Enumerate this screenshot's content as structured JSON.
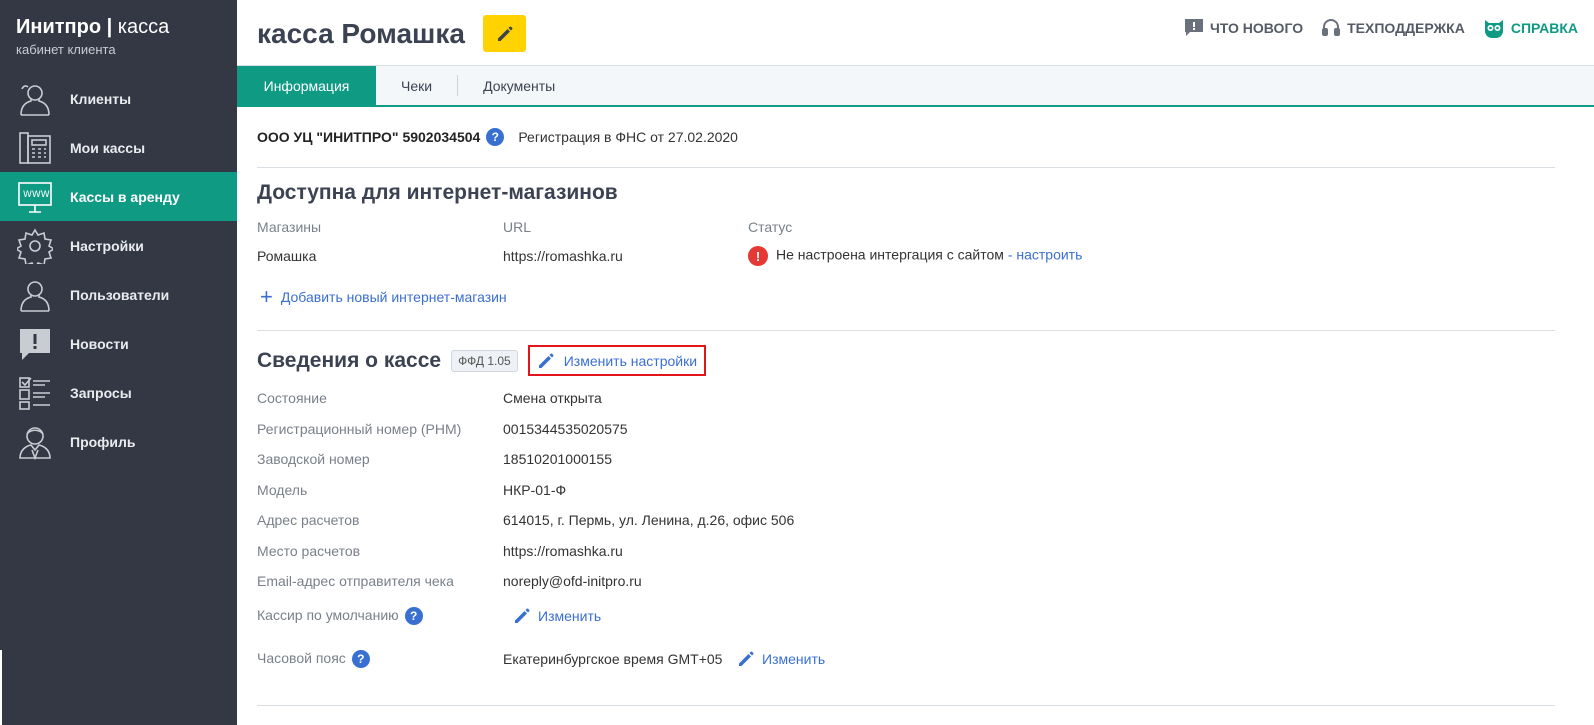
{
  "brand": {
    "name": "Инитпро",
    "separator": "|",
    "product": "касса",
    "subtitle": "кабинет клиента"
  },
  "sidebar": {
    "items": [
      {
        "label": "Клиенты",
        "icon": "users-icon",
        "active": false
      },
      {
        "label": "Мои кассы",
        "icon": "cash-register-icon",
        "active": false
      },
      {
        "label": "Кассы в аренду",
        "icon": "www-monitor-icon",
        "active": true
      },
      {
        "label": "Настройки",
        "icon": "gear-icon",
        "active": false
      },
      {
        "label": "Пользователи",
        "icon": "users-icon",
        "active": false
      },
      {
        "label": "Новости",
        "icon": "news-icon",
        "active": false
      },
      {
        "label": "Запросы",
        "icon": "checklist-icon",
        "active": false
      },
      {
        "label": "Профиль",
        "icon": "profile-icon",
        "active": false
      }
    ]
  },
  "header": {
    "title": "касса Ромашка",
    "links": {
      "whats_new": "ЧТО НОВОГО",
      "support": "ТЕХПОДДЕРЖКА",
      "help": "СПРАВКА"
    }
  },
  "tabs": {
    "info": "Информация",
    "checks": "Чеки",
    "documents": "Документы"
  },
  "org": {
    "name": "ООО УЦ \"ИНИТПРО\" 5902034504",
    "help": "?",
    "registration": "Регистрация в ФНС от 27.02.2020"
  },
  "shops": {
    "title": "Доступна для интернет-магазинов",
    "columns": {
      "shops": "Магазины",
      "url": "URL",
      "status": "Статус"
    },
    "row": {
      "shop": "Ромашка",
      "url": "https://romashka.ru",
      "status": "Не настроена интергация с сайтом",
      "status_link": "- настроить",
      "error_mark": "!"
    },
    "add_plus": "+",
    "add_label": "Добавить новый интернет-магазин"
  },
  "kassa": {
    "title": "Сведения о кассе",
    "ffd": "ФФД 1.05",
    "edit_settings": "Изменить настройки",
    "props": [
      {
        "label": "Состояние",
        "value": "Смена открыта"
      },
      {
        "label": "Регистрационный номер (РНМ)",
        "value": "0015344535020575"
      },
      {
        "label": "Заводской номер",
        "value": "18510201000155"
      },
      {
        "label": "Модель",
        "value": "НКР-01-Ф"
      },
      {
        "label": "Адрес расчетов",
        "value": "614015, г. Пермь, ул. Ленина, д.26, офис 506"
      },
      {
        "label": "Место расчетов",
        "value": "https://romashka.ru"
      },
      {
        "label": "Email-адрес отправителя чека",
        "value": "noreply@ofd-initpro.ru"
      }
    ],
    "cashier": {
      "label": "Кассир по умолчанию",
      "help": "?",
      "edit": "Изменить"
    },
    "timezone": {
      "label": "Часовой пояс",
      "help": "?",
      "value": "Екатеринбургское время GMT+05",
      "edit": "Изменить"
    }
  },
  "colors": {
    "sidebar_bg": "#343844",
    "accent": "#0f9a84",
    "link": "#3a6fd2",
    "error": "#e53935",
    "highlight_border": "#e4141b",
    "title_edit_bg": "#ffd200"
  }
}
